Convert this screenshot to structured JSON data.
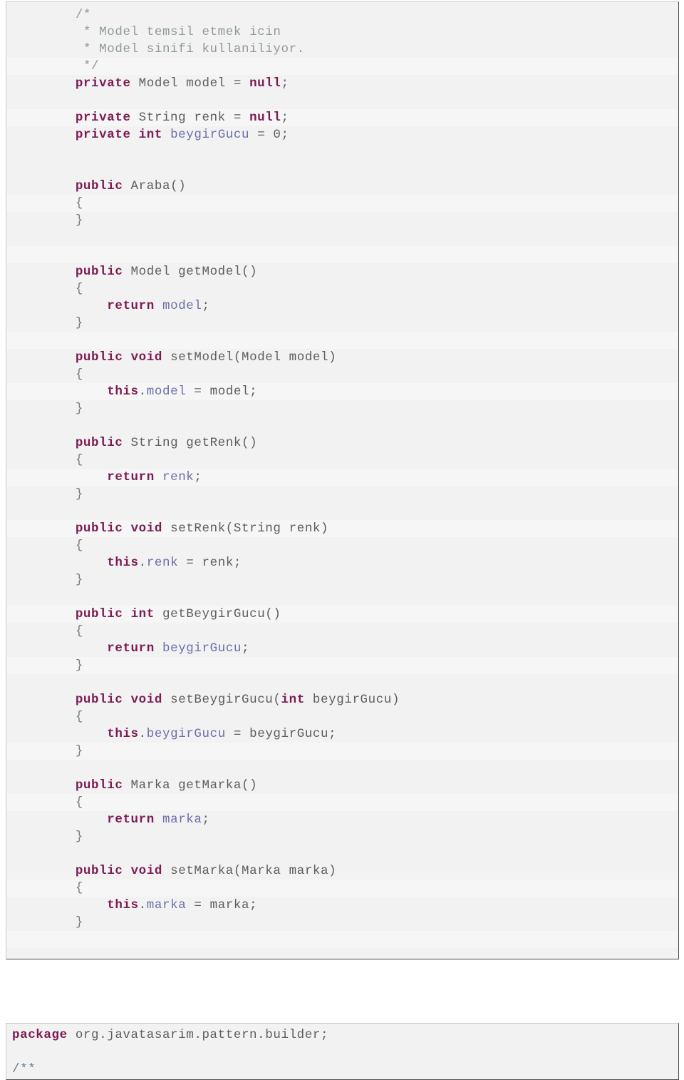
{
  "document": {
    "type": "code-listing",
    "language": "Java",
    "blocks": [
      {
        "id": "araba-class-body",
        "lines": [
          {
            "indent": 2,
            "tokens": [
              {
                "t": "/*",
                "c": "cmt"
              }
            ]
          },
          {
            "indent": 2,
            "tokens": [
              {
                "t": " * Model temsil etmek icin",
                "c": "cmt"
              }
            ]
          },
          {
            "indent": 2,
            "tokens": [
              {
                "t": " * Model sinifi kullaniliyor.",
                "c": "cmt"
              }
            ]
          },
          {
            "indent": 2,
            "tokens": [
              {
                "t": " */",
                "c": "cmt"
              }
            ]
          },
          {
            "indent": 2,
            "tokens": [
              {
                "t": "private",
                "c": "kw"
              },
              {
                "t": " Model model = ",
                "c": "pln"
              },
              {
                "t": "null",
                "c": "kw"
              },
              {
                "t": ";",
                "c": "pln"
              }
            ]
          },
          {
            "indent": 2,
            "tokens": []
          },
          {
            "indent": 2,
            "tokens": [
              {
                "t": "private",
                "c": "kw"
              },
              {
                "t": " String renk = ",
                "c": "pln"
              },
              {
                "t": "null",
                "c": "kw"
              },
              {
                "t": ";",
                "c": "pln"
              }
            ]
          },
          {
            "indent": 2,
            "tokens": [
              {
                "t": "private",
                "c": "kw"
              },
              {
                "t": " ",
                "c": "pln"
              },
              {
                "t": "int",
                "c": "kw"
              },
              {
                "t": " ",
                "c": "pln"
              },
              {
                "t": "beygirGucu",
                "c": "fld"
              },
              {
                "t": " = 0;",
                "c": "pln"
              }
            ]
          },
          {
            "indent": 2,
            "tokens": []
          },
          {
            "indent": 2,
            "tokens": []
          },
          {
            "indent": 2,
            "tokens": [
              {
                "t": "public",
                "c": "kw"
              },
              {
                "t": " Araba()",
                "c": "pln"
              }
            ]
          },
          {
            "indent": 2,
            "tokens": [
              {
                "t": "{",
                "c": "brace"
              }
            ]
          },
          {
            "indent": 2,
            "tokens": [
              {
                "t": "}",
                "c": "brace"
              }
            ]
          },
          {
            "indent": 2,
            "tokens": []
          },
          {
            "indent": 2,
            "tokens": []
          },
          {
            "indent": 2,
            "tokens": [
              {
                "t": "public",
                "c": "kw"
              },
              {
                "t": " Model getModel()",
                "c": "pln"
              }
            ]
          },
          {
            "indent": 2,
            "tokens": [
              {
                "t": "{",
                "c": "brace"
              }
            ]
          },
          {
            "indent": 2,
            "tokens": [
              {
                "t": "    ",
                "c": "pln"
              },
              {
                "t": "return",
                "c": "kw"
              },
              {
                "t": " ",
                "c": "pln"
              },
              {
                "t": "model",
                "c": "fld"
              },
              {
                "t": ";",
                "c": "pln"
              }
            ]
          },
          {
            "indent": 2,
            "tokens": [
              {
                "t": "}",
                "c": "brace"
              }
            ]
          },
          {
            "indent": 2,
            "tokens": []
          },
          {
            "indent": 2,
            "tokens": [
              {
                "t": "public",
                "c": "kw"
              },
              {
                "t": " ",
                "c": "pln"
              },
              {
                "t": "void",
                "c": "kw"
              },
              {
                "t": " setModel(Model model)",
                "c": "pln"
              }
            ]
          },
          {
            "indent": 2,
            "tokens": [
              {
                "t": "{",
                "c": "brace"
              }
            ]
          },
          {
            "indent": 2,
            "tokens": [
              {
                "t": "    ",
                "c": "pln"
              },
              {
                "t": "this",
                "c": "kw"
              },
              {
                "t": ".",
                "c": "pln"
              },
              {
                "t": "model",
                "c": "fld"
              },
              {
                "t": " = model;",
                "c": "pln"
              }
            ]
          },
          {
            "indent": 2,
            "tokens": [
              {
                "t": "}",
                "c": "brace"
              }
            ]
          },
          {
            "indent": 2,
            "tokens": []
          },
          {
            "indent": 2,
            "tokens": [
              {
                "t": "public",
                "c": "kw"
              },
              {
                "t": " String getRenk()",
                "c": "pln"
              }
            ]
          },
          {
            "indent": 2,
            "tokens": [
              {
                "t": "{",
                "c": "brace"
              }
            ]
          },
          {
            "indent": 2,
            "tokens": [
              {
                "t": "    ",
                "c": "pln"
              },
              {
                "t": "return",
                "c": "kw"
              },
              {
                "t": " ",
                "c": "pln"
              },
              {
                "t": "renk",
                "c": "fld"
              },
              {
                "t": ";",
                "c": "pln"
              }
            ]
          },
          {
            "indent": 2,
            "tokens": [
              {
                "t": "}",
                "c": "brace"
              }
            ]
          },
          {
            "indent": 2,
            "tokens": []
          },
          {
            "indent": 2,
            "tokens": [
              {
                "t": "public",
                "c": "kw"
              },
              {
                "t": " ",
                "c": "pln"
              },
              {
                "t": "void",
                "c": "kw"
              },
              {
                "t": " setRenk(String renk)",
                "c": "pln"
              }
            ]
          },
          {
            "indent": 2,
            "tokens": [
              {
                "t": "{",
                "c": "brace"
              }
            ]
          },
          {
            "indent": 2,
            "tokens": [
              {
                "t": "    ",
                "c": "pln"
              },
              {
                "t": "this",
                "c": "kw"
              },
              {
                "t": ".",
                "c": "pln"
              },
              {
                "t": "renk",
                "c": "fld"
              },
              {
                "t": " = renk;",
                "c": "pln"
              }
            ]
          },
          {
            "indent": 2,
            "tokens": [
              {
                "t": "}",
                "c": "brace"
              }
            ]
          },
          {
            "indent": 2,
            "tokens": []
          },
          {
            "indent": 2,
            "tokens": [
              {
                "t": "public",
                "c": "kw"
              },
              {
                "t": " ",
                "c": "pln"
              },
              {
                "t": "int",
                "c": "kw"
              },
              {
                "t": " getBeygirGucu()",
                "c": "pln"
              }
            ]
          },
          {
            "indent": 2,
            "tokens": [
              {
                "t": "{",
                "c": "brace"
              }
            ]
          },
          {
            "indent": 2,
            "tokens": [
              {
                "t": "    ",
                "c": "pln"
              },
              {
                "t": "return",
                "c": "kw"
              },
              {
                "t": " ",
                "c": "pln"
              },
              {
                "t": "beygirGucu",
                "c": "fld"
              },
              {
                "t": ";",
                "c": "pln"
              }
            ]
          },
          {
            "indent": 2,
            "tokens": [
              {
                "t": "}",
                "c": "brace"
              }
            ]
          },
          {
            "indent": 2,
            "tokens": []
          },
          {
            "indent": 2,
            "tokens": [
              {
                "t": "public",
                "c": "kw"
              },
              {
                "t": " ",
                "c": "pln"
              },
              {
                "t": "void",
                "c": "kw"
              },
              {
                "t": " setBeygirGucu(",
                "c": "pln"
              },
              {
                "t": "int",
                "c": "kw"
              },
              {
                "t": " beygirGucu)",
                "c": "pln"
              }
            ]
          },
          {
            "indent": 2,
            "tokens": [
              {
                "t": "{",
                "c": "brace"
              }
            ]
          },
          {
            "indent": 2,
            "tokens": [
              {
                "t": "    ",
                "c": "pln"
              },
              {
                "t": "this",
                "c": "kw"
              },
              {
                "t": ".",
                "c": "pln"
              },
              {
                "t": "beygirGucu",
                "c": "fld"
              },
              {
                "t": " = beygirGucu;",
                "c": "pln"
              }
            ]
          },
          {
            "indent": 2,
            "tokens": [
              {
                "t": "}",
                "c": "brace"
              }
            ]
          },
          {
            "indent": 2,
            "tokens": []
          },
          {
            "indent": 2,
            "tokens": [
              {
                "t": "public",
                "c": "kw"
              },
              {
                "t": " Marka getMarka()",
                "c": "pln"
              }
            ]
          },
          {
            "indent": 2,
            "tokens": [
              {
                "t": "{",
                "c": "brace"
              }
            ]
          },
          {
            "indent": 2,
            "tokens": [
              {
                "t": "    ",
                "c": "pln"
              },
              {
                "t": "return",
                "c": "kw"
              },
              {
                "t": " ",
                "c": "pln"
              },
              {
                "t": "marka",
                "c": "fld"
              },
              {
                "t": ";",
                "c": "pln"
              }
            ]
          },
          {
            "indent": 2,
            "tokens": [
              {
                "t": "}",
                "c": "brace"
              }
            ]
          },
          {
            "indent": 2,
            "tokens": []
          },
          {
            "indent": 2,
            "tokens": [
              {
                "t": "public",
                "c": "kw"
              },
              {
                "t": " ",
                "c": "pln"
              },
              {
                "t": "void",
                "c": "kw"
              },
              {
                "t": " setMarka(Marka marka)",
                "c": "pln"
              }
            ]
          },
          {
            "indent": 2,
            "tokens": [
              {
                "t": "{",
                "c": "brace"
              }
            ]
          },
          {
            "indent": 2,
            "tokens": [
              {
                "t": "    ",
                "c": "pln"
              },
              {
                "t": "this",
                "c": "kw"
              },
              {
                "t": ".",
                "c": "pln"
              },
              {
                "t": "marka",
                "c": "fld"
              },
              {
                "t": " = marka;",
                "c": "pln"
              }
            ]
          },
          {
            "indent": 2,
            "tokens": [
              {
                "t": "}",
                "c": "brace"
              }
            ]
          },
          {
            "indent": 2,
            "tokens": []
          },
          {
            "indent": 2,
            "tokens": []
          },
          {
            "indent": 0,
            "tokens": [
              {
                "t": "}",
                "c": "brace"
              }
            ]
          }
        ]
      },
      {
        "id": "package-declaration",
        "lines": [
          {
            "indent": 0,
            "tokens": [
              {
                "t": "package",
                "c": "kw"
              },
              {
                "t": " org.javatasarim.pattern.builder;",
                "c": "pln"
              }
            ]
          },
          {
            "indent": 0,
            "tokens": []
          },
          {
            "indent": 0,
            "tokens": [
              {
                "t": "/**",
                "c": "cmt2"
              }
            ]
          }
        ]
      }
    ]
  },
  "colors": {
    "page_background": "#ffffff",
    "code_background": "#f2f2f2",
    "code_border": "#c9c9c9",
    "code_border_shadow": "#4a4a4a",
    "keyword": "#7b1b52",
    "comment": "#8f9a93",
    "comment_doc": "#6b7a96",
    "field": "#6a6fa8",
    "plain": "#5d5d5d",
    "brace": "#7c7c7c"
  }
}
